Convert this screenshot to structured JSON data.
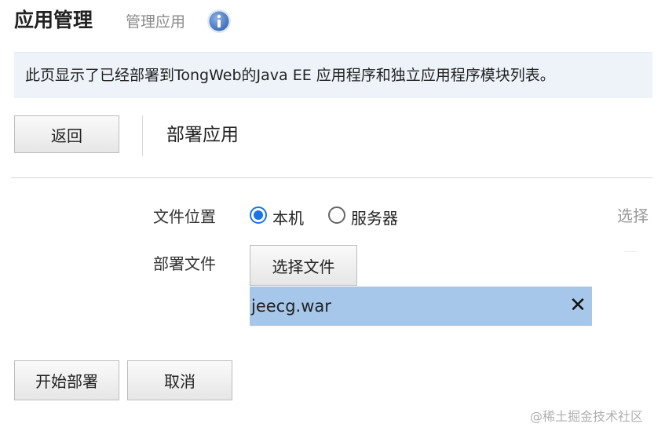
{
  "header": {
    "title": "应用管理",
    "subtitle": "管理应用",
    "info_icon": "info-icon"
  },
  "banner": {
    "text": "此页显示了已经部署到TongWeb的Java EE 应用程序和独立应用程序模块列表。"
  },
  "toolbar": {
    "back_label": "返回",
    "section_title": "部署应用"
  },
  "form": {
    "location_label": "文件位置",
    "location_options": [
      {
        "label": "本机",
        "checked": true
      },
      {
        "label": "服务器",
        "checked": false
      }
    ],
    "select_link": "选择",
    "file_label": "部署文件",
    "choose_file_label": "选择文件",
    "selected_file": "jeecg.war",
    "remove_icon": "close-icon"
  },
  "actions": {
    "start_label": "开始部署",
    "cancel_label": "取消"
  },
  "watermark": "@稀土掘金技术社区",
  "colors": {
    "banner_bg": "#eef3f9",
    "file_chip_bg": "#a6c7ea",
    "radio_accent": "#1a73e8",
    "info_icon": "#4a7cc2"
  }
}
